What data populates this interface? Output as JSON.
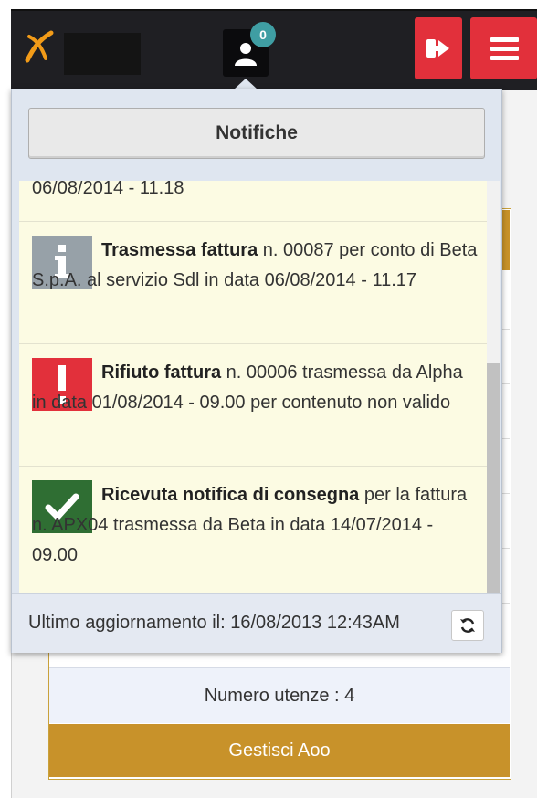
{
  "header": {
    "notifications_count": "0",
    "icons": {
      "logo": "x-logo",
      "user": "user-icon",
      "exit": "sign-out-icon",
      "menu": "menu-icon"
    },
    "colors": {
      "bar": "#1f1f23",
      "danger": "#e2303b",
      "badge": "#3f9ea3"
    }
  },
  "background": {
    "users_count_label": "Numero utenze : 4",
    "manage_button_label": "Gestisci Aoo",
    "accent": "#c8922a"
  },
  "notifications": {
    "title": "Notifiche",
    "partial_item_date": "06/08/2014 - 11.18",
    "items": [
      {
        "type": "info",
        "icon": "info-icon",
        "color": "#97a1a8",
        "bold": "Trasmessa  fattura",
        "text": " n. 00087 per conto di Beta S.p.A. al servizio Sdl in data 06/08/2014 - 11.17"
      },
      {
        "type": "error",
        "icon": "exclamation-icon",
        "color": "#e2303b",
        "bold": "Rifiuto fattura",
        "text": " n. 00006 trasmessa da Alpha in data 01/08/2014 - 09.00 per contenuto non valido"
      },
      {
        "type": "success",
        "icon": "check-icon",
        "color": "#2f6e33",
        "bold": "Ricevuta notifica di consegna",
        "text": " per la fattura n. APX04 trasmessa da Beta in data 14/07/2014 - 09.00"
      }
    ],
    "footer_text": "Ultimo aggiornamento il: 16/08/2013 12:43AM",
    "refresh_icon": "refresh-icon"
  }
}
